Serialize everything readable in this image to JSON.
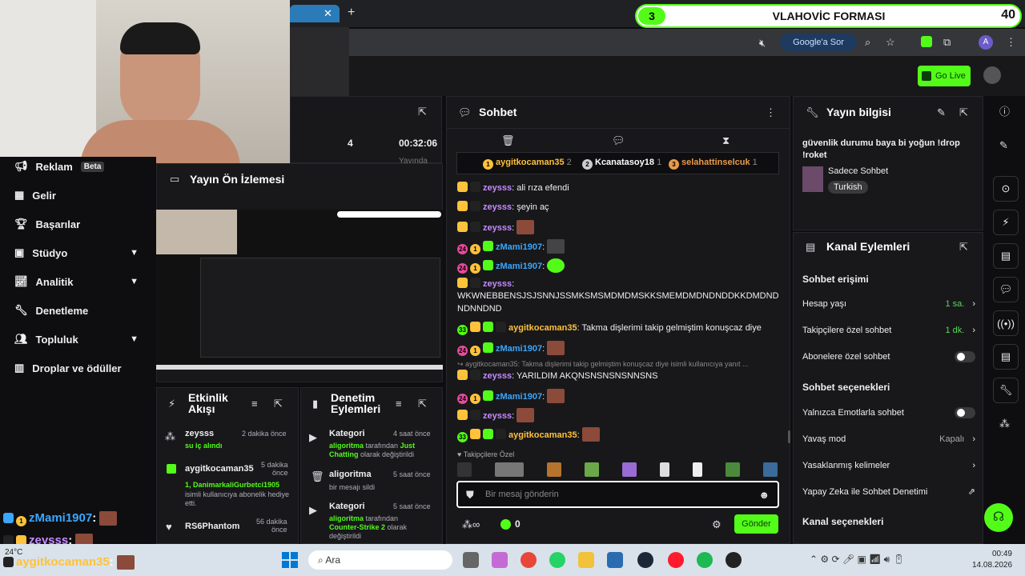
{
  "browser": {
    "overlay_title": "VLAHOVİC FORMASI",
    "overlay_left_num": "3",
    "overlay_right_num": "40",
    "search_btn": "Google'a Sor",
    "avatar_letter": "A"
  },
  "topbar": {
    "go_live": "Go Live"
  },
  "sidebar": {
    "items": [
      {
        "label": "Reklam",
        "badge": "Beta"
      },
      {
        "label": "Gelir"
      },
      {
        "label": "Başarılar"
      },
      {
        "label": "Stüdyo"
      },
      {
        "label": "Analitik"
      },
      {
        "label": "Denetleme"
      },
      {
        "label": "Topluluk"
      },
      {
        "label": "Droplar ve ödüller"
      }
    ]
  },
  "stream_stats": {
    "time": "00:32:06",
    "partial": "Yayında",
    "partial_left": "4"
  },
  "preview": {
    "title": "Yayın Ön İzlemesi"
  },
  "activity": {
    "title_line1": "Etkinlik",
    "title_line2": "Akışı",
    "events": [
      {
        "user": "zeysss",
        "time": "2 dakika önce",
        "detail": "su iç alındı"
      },
      {
        "user": "aygitkocaman35",
        "time_line1": "5 dakika",
        "time_line2": "önce",
        "detail": "1, DanimarkaliGurbetci1905",
        "detail2": "isimli kullanıcıya abonelik hediye etti."
      },
      {
        "user": "RS6Phantom",
        "time_line1": "56 dakika",
        "time_line2": "önce"
      }
    ]
  },
  "mod_actions": {
    "title_line1": "Denetim",
    "title_line2": "Eylemleri",
    "events": [
      {
        "title": "Kategori",
        "time": "4 saat önce",
        "who": "aligoritma",
        "mid": " tarafından ",
        "what": "Just Chatting",
        "tail": " olarak değiştirildi"
      },
      {
        "title": "aligoritma",
        "time": "5 saat önce",
        "text": "bir mesajı sildi"
      },
      {
        "title": "Kategori",
        "time": "5 saat önce",
        "who": "aligoritma",
        "mid": " tarafından",
        "what": "Counter-Strike 2",
        "tail": " olarak değiştirildi"
      }
    ]
  },
  "chat": {
    "title": "Sohbet",
    "leaders": [
      {
        "rank": "1",
        "name": "aygitkocaman35",
        "count": "2"
      },
      {
        "rank": "2",
        "name": "Kcanatasoy18",
        "count": "1"
      },
      {
        "rank": "3",
        "name": "selahattinselcuk",
        "count": "1"
      }
    ],
    "messages": [
      {
        "user": "zeysss",
        "text": ": ali rıza efendi"
      },
      {
        "user": "zeysss",
        "text": ": şeyin aç"
      },
      {
        "user": "zeysss",
        "text": ":"
      },
      {
        "user": "zMami1907",
        "text": ":"
      },
      {
        "user": "zMami1907",
        "text": ":"
      },
      {
        "user": "zeysss",
        "text": ":"
      },
      {
        "user": "aygitkocaman35",
        "text": ": Takma dişlerimi takip gelmiştim konuşcaz diye"
      },
      {
        "user": "zMami1907",
        "text": ":"
      },
      {
        "user": "zeysss",
        "text": ": YARILDIM AKQNSNSNSNSNNSNS"
      },
      {
        "user": "zMami1907",
        "text": ":"
      },
      {
        "user": "zeysss",
        "text": ":"
      },
      {
        "user": "aygitkocaman35",
        "text": ":"
      }
    ],
    "long_line1": "WKWNEBBENSJSJSNNJSSMKSMSMDMDMSKKSMEMDMDNDNDDKKDMDND",
    "long_line2": "NDNNDND",
    "reply_preview": "aygitkocaman35: Takma dişlerimi takip gelmiştim konuşcaz diye isimli kullanıcıya yanıt ...",
    "badge_num_24": "24",
    "badge_num_33": "33",
    "badge_one": "1",
    "followers_only": "Takipçilere Özel",
    "input_placeholder": "Bir mesaj gönderin",
    "points": "0",
    "send": "Gönder"
  },
  "stream_info": {
    "title": "Yayın bilgisi",
    "desc_line1": "güvenlik durumu baya bi yoğun !drop",
    "desc_line2": "!roket",
    "category": "Sadece Sohbet",
    "language": "Turkish"
  },
  "channel_actions": {
    "title": "Kanal Eylemleri",
    "chat_access": "Sohbet erişimi",
    "account_age": "Hesap yaşı",
    "account_age_val": "1 sa.",
    "followers_chat": "Takipçilere özel sohbet",
    "followers_chat_val": "1 dk.",
    "subs_chat": "Abonelere özel sohbet",
    "chat_options": "Sohbet seçenekleri",
    "emote_only": "Yalnızca Emotlarla sohbet",
    "slow_mode": "Yavaş mod",
    "slow_mode_val": "Kapalı",
    "banned_words": "Yasaklanmış kelimeler",
    "ai_mod": "Yapay Zeka ile Sohbet Denetimi",
    "channel_options": "Kanal seçenekleri"
  },
  "overlay_chat": [
    {
      "user": "zMami1907",
      "sep": ":"
    },
    {
      "user": "zeysss",
      "sep": ":"
    },
    {
      "user": "aygitkocaman35",
      "sep": ":"
    }
  ],
  "taskbar": {
    "search": "Ara",
    "weather": "24°C",
    "time": "00:49",
    "date": "14.08.2026"
  },
  "colors": {
    "accent": "#53fc18",
    "brand_green": "#53fc18",
    "user_green": "#53fc18",
    "user_purple": "#c78bff",
    "user_blue": "#3aa7ff",
    "user_yellow": "#ffc23a"
  }
}
